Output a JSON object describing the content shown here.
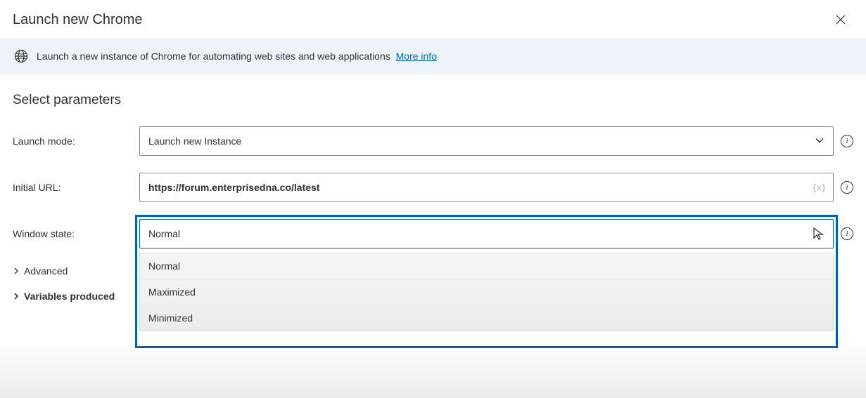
{
  "header": {
    "title": "Launch new Chrome"
  },
  "banner": {
    "text": "Launch a new instance of Chrome for automating web sites and web applications",
    "link_label": "More info"
  },
  "section": {
    "title": "Select parameters"
  },
  "form": {
    "launch_mode": {
      "label": "Launch mode:",
      "value": "Launch new Instance"
    },
    "initial_url": {
      "label": "Initial URL:",
      "value": "https://forum.enterprisedna.co/latest",
      "var_hint": "{x}"
    },
    "window_state": {
      "label": "Window state:",
      "value": "Normal",
      "options": [
        "Normal",
        "Maximized",
        "Minimized"
      ]
    }
  },
  "expanders": {
    "advanced": "Advanced",
    "variables": "Variables produced"
  }
}
